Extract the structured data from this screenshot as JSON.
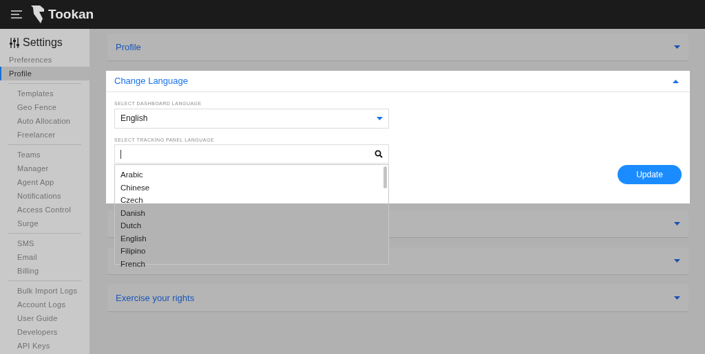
{
  "header": {
    "title": "Tookan"
  },
  "sidebar": {
    "title": "Settings",
    "groups": [
      [
        {
          "label": "Preferences",
          "selected": false
        },
        {
          "label": "Profile",
          "selected": true
        }
      ],
      [
        {
          "label": "Templates",
          "selected": false
        },
        {
          "label": "Geo Fence",
          "selected": false
        },
        {
          "label": "Auto Allocation",
          "selected": false
        },
        {
          "label": "Freelancer",
          "selected": false
        }
      ],
      [
        {
          "label": "Teams",
          "selected": false
        },
        {
          "label": "Manager",
          "selected": false
        },
        {
          "label": "Agent App",
          "selected": false
        },
        {
          "label": "Notifications",
          "selected": false
        },
        {
          "label": "Access Control",
          "selected": false
        },
        {
          "label": "Surge",
          "selected": false
        }
      ],
      [
        {
          "label": "SMS",
          "selected": false
        },
        {
          "label": "Email",
          "selected": false
        },
        {
          "label": "Billing",
          "selected": false
        }
      ],
      [
        {
          "label": "Bulk Import Logs",
          "selected": false
        },
        {
          "label": "Account Logs",
          "selected": false
        },
        {
          "label": "User Guide",
          "selected": false
        },
        {
          "label": "Developers",
          "selected": false
        },
        {
          "label": "API Keys",
          "selected": false
        }
      ]
    ]
  },
  "cards": [
    {
      "kind": "collapsed",
      "title": "Profile",
      "expanded": false
    },
    {
      "kind": "language",
      "title": "Change Language",
      "expanded": true,
      "dashboard": {
        "label": "SELECT DASHBOARD LANGUAGE",
        "value": "English"
      },
      "tracking": {
        "label": "SELECT TRACKING PANEL LANGUAGE",
        "options": [
          "Arabic",
          "Chinese",
          "Czech",
          "Danish",
          "Dutch",
          "English",
          "Filipino",
          "French"
        ]
      },
      "button": "Update"
    },
    {
      "kind": "collapsed",
      "expanded": false
    },
    {
      "kind": "collapsed",
      "expanded": false
    },
    {
      "kind": "collapsed",
      "title": "Exercise your rights",
      "expanded": false
    }
  ]
}
